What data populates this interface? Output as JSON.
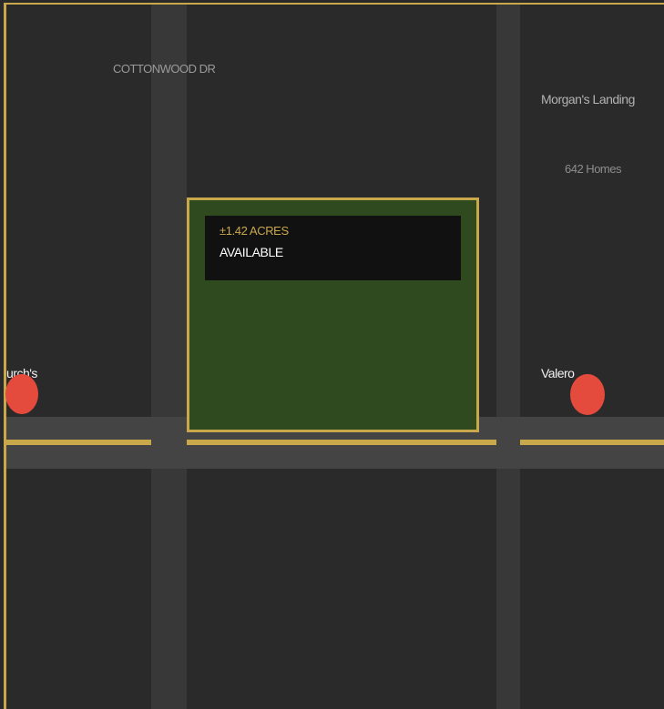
{
  "map": {
    "streets": [
      {
        "name": "COTTONWOOD DR"
      }
    ],
    "community": {
      "name": "Morgan's Landing",
      "homes": "642 Homes"
    },
    "parcel": {
      "size": "±1.42 ACRES",
      "status": "AVAILABLE",
      "highlight_color": "#c9a84c",
      "fill_color": "#2f4a1f"
    },
    "pois": [
      {
        "name": "urch's",
        "marker_color": "#e54b3c"
      },
      {
        "name": "Valero",
        "marker_color": "#e54b3c"
      }
    ],
    "colors": {
      "background": "#2a2a2a",
      "road": "#444444",
      "road_centerline": "#c9a84c"
    }
  }
}
